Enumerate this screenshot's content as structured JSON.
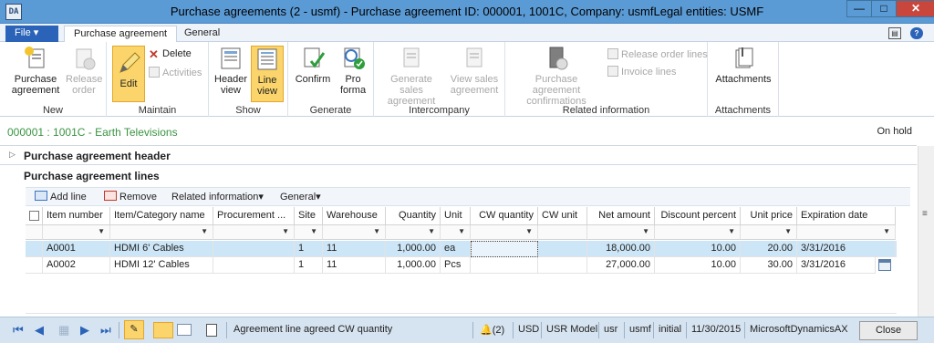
{
  "window": {
    "title": "Purchase agreements (2 - usmf) - Purchase agreement ID: 000001, 1001C, Company: usmfLegal entities: USMF",
    "app_icon": "DA"
  },
  "tabs": {
    "file": "File",
    "purchase_agreement": "Purchase agreement",
    "general": "General"
  },
  "ribbon": {
    "new": {
      "label": "New",
      "purchase_agreement": "Purchase agreement",
      "release_order": "Release order"
    },
    "maintain": {
      "label": "Maintain",
      "edit": "Edit",
      "delete": "Delete",
      "activities": "Activities"
    },
    "show": {
      "label": "Show",
      "header_view": "Header view",
      "line_view": "Line view"
    },
    "generate": {
      "label": "Generate",
      "confirm": "Confirm",
      "pro_forma": "Pro forma"
    },
    "intercompany": {
      "label": "Intercompany",
      "generate_sales": "Generate sales agreement",
      "view_sales": "View sales agreement"
    },
    "related": {
      "label": "Related information",
      "confirmations": "Purchase agreement confirmations",
      "release_order_lines": "Release order lines",
      "invoice_lines": "Invoice lines"
    },
    "attachments": {
      "label": "Attachments",
      "button": "Attachments"
    }
  },
  "record": {
    "title": "000001 : 1001C - Earth Televisions",
    "status": "On hold"
  },
  "sections": {
    "header": "Purchase agreement header",
    "lines": "Purchase agreement lines"
  },
  "lines_toolbar": {
    "add_line": "Add line",
    "remove": "Remove",
    "related_information": "Related information",
    "general": "General"
  },
  "grid": {
    "columns": [
      "Item number",
      "Item/Category name",
      "Procurement ...",
      "Site",
      "Warehouse",
      "Quantity",
      "Unit",
      "CW quantity",
      "CW unit",
      "Net amount",
      "Discount percent",
      "Unit price",
      "Expiration date"
    ],
    "rows": [
      [
        "A0001",
        "HDMI 6' Cables",
        "",
        "1",
        "11",
        "1,000.00",
        "ea",
        "",
        "",
        "18,000.00",
        "10.00",
        "20.00",
        "3/31/2016"
      ],
      [
        "A0002",
        "HDMI 12' Cables",
        "",
        "1",
        "11",
        "1,000.00",
        "Pcs",
        "",
        "",
        "27,000.00",
        "10.00",
        "30.00",
        "3/31/2016"
      ]
    ]
  },
  "statusbar": {
    "help_text": "Agreement line agreed CW quantity",
    "notifications": "(2)",
    "currency": "USD",
    "model": "USR Model",
    "user": "usr",
    "company": "usmf",
    "layer": "initial",
    "date": "11/30/2015",
    "system": "MicrosoftDynamicsAX",
    "close": "Close"
  },
  "colors": {
    "title_bar": "#5b9bd5",
    "file_tab": "#2a63b8",
    "record_title": "#3a9442",
    "selected_row": "#cde6f7",
    "highlight": "#fbd56b",
    "status_bar": "#d6e3f0"
  }
}
